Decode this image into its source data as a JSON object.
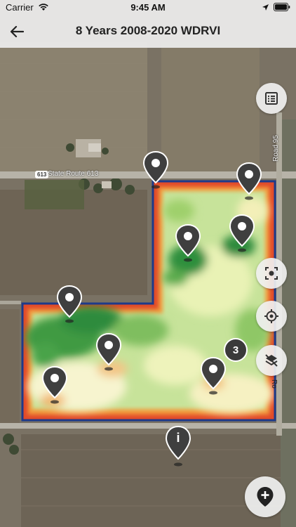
{
  "status_bar": {
    "carrier": "Carrier",
    "time": "9:45 AM"
  },
  "nav": {
    "title": "8 Years 2008-2020 WDRVI",
    "back_icon": "arrow-left-icon"
  },
  "map": {
    "road_labels": {
      "state_route": "State Route 613",
      "shield": "613",
      "road_east": "Road 95",
      "road_east_partial": "Ro"
    },
    "cluster_count": "3",
    "info_pin_label": "i",
    "colors": {
      "pin": "#3f3f3f",
      "boundary": "#1e3a8a",
      "high": "#2e8b3e",
      "mid": "#a6d36a",
      "low": "#f7f3c4",
      "poor": "#e45a2d"
    }
  },
  "controls": {
    "list_icon": "list-icon",
    "focus_icon": "focus-frame-icon",
    "locate_icon": "crosshair-icon",
    "layers_icon": "layers-off-icon",
    "add_pin_icon": "add-location-icon"
  }
}
